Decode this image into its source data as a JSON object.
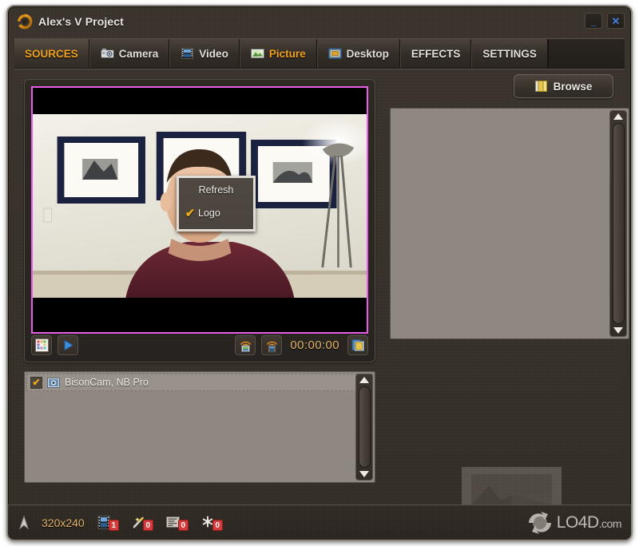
{
  "window": {
    "title": "Alex's V Project",
    "logo_icon": "swirl-logo-icon",
    "minimize_label": "_",
    "close_label": "✕"
  },
  "tabs": [
    {
      "label": "SOURCES",
      "icon": "",
      "state": "selected"
    },
    {
      "label": "Camera",
      "icon": "camera-icon",
      "state": "normal"
    },
    {
      "label": "Video",
      "icon": "film-icon",
      "state": "normal"
    },
    {
      "label": "Picture",
      "icon": "picture-icon",
      "state": "highlighted"
    },
    {
      "label": "Desktop",
      "icon": "desktop-icon",
      "state": "normal"
    },
    {
      "label": "EFFECTS",
      "icon": "",
      "state": "normal"
    },
    {
      "label": "SETTINGS",
      "icon": "",
      "state": "normal"
    }
  ],
  "preview": {
    "border_color": "#e85ce8",
    "context_menu": {
      "items": [
        {
          "label": "Refresh",
          "checked": false,
          "check_glyph": ""
        },
        {
          "label": "Logo",
          "checked": true,
          "check_glyph": "✔"
        }
      ],
      "check_color": "#f0a81e"
    },
    "toolbar": {
      "palette_icon": "color-palette-icon",
      "play_icon": "play-icon",
      "broadcast_image_icon": "broadcast-image-icon",
      "broadcast_video_icon": "broadcast-video-icon",
      "timecode": "00:00:00",
      "snapshot_icon": "copy-files-icon"
    }
  },
  "source_list": {
    "items": [
      {
        "label": "BisonCam, NB Pro",
        "checked": true,
        "check_glyph": "✔",
        "icon": "webcam-icon"
      }
    ]
  },
  "right_panel": {
    "browse": {
      "label": "Browse",
      "icon": "folder-icon"
    },
    "list_items": [],
    "thumbnail_icon": "picture-thumbnail"
  },
  "status_bar": {
    "antenna_icon": "antenna-icon",
    "resolution": "320x240",
    "counters": [
      {
        "icon": "film-strip-icon",
        "count": "1"
      },
      {
        "icon": "magic-wand-icon",
        "count": "0"
      },
      {
        "icon": "text-overlay-icon",
        "count": "0"
      },
      {
        "icon": "effects-gear-icon",
        "count": "0"
      }
    ],
    "watermark": {
      "text": "LO4D",
      "suffix": ".com",
      "icon": "refresh-circle-icon"
    }
  },
  "colors": {
    "accent_orange": "#f0a01e",
    "preview_border": "#e85ce8",
    "badge_red": "#d63a3a",
    "timecode": "#e2b36a"
  }
}
